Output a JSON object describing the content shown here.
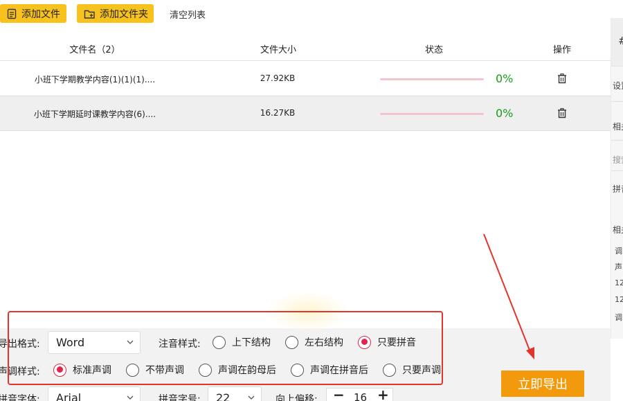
{
  "toolbar": {
    "add_file": "添加文件",
    "add_folder": "添加文件夹",
    "clear_list": "清空列表"
  },
  "table": {
    "headers": {
      "name": "文件名（2）",
      "size": "文件大小",
      "status": "状态",
      "action": "操作"
    },
    "rows": [
      {
        "name": "小班下学期教学内容(1)(1)(1)....",
        "size": "27.92KB",
        "progress_text": "0%",
        "progress": 0
      },
      {
        "name": "小班下学期延时课教学内容(6)....",
        "size": "16.27KB",
        "progress_text": "0%",
        "progress": 0
      }
    ]
  },
  "side_panel": {
    "items": [
      "#",
      "设置",
      "相关",
      "搜索",
      "拼音",
      "相关",
      "调",
      "声",
      "12",
      "12",
      "调"
    ]
  },
  "settings": {
    "export_format_label": "导出格式:",
    "export_format_value": "Word",
    "annotation_label": "注音样式:",
    "annotation_options": [
      {
        "label": "上下结构",
        "selected": false
      },
      {
        "label": "左右结构",
        "selected": false
      },
      {
        "label": "只要拼音",
        "selected": true
      }
    ],
    "tone_label": "声调样式:",
    "tone_options": [
      {
        "label": "标准声调",
        "selected": true
      },
      {
        "label": "不带声调",
        "selected": false
      },
      {
        "label": "声调在韵母后",
        "selected": false
      },
      {
        "label": "声调在拼音后",
        "selected": false
      },
      {
        "label": "只要声调",
        "selected": false
      }
    ],
    "pinyin_font_label": "拼音字体:",
    "pinyin_font_value": "Arial",
    "pinyin_size_label": "拼音字号:",
    "pinyin_size_value": "22",
    "offset_label": "向上偏移:",
    "offset_value": "16",
    "minus": "−",
    "plus": "+"
  },
  "export_button": "立即导出",
  "colors": {
    "toolbar_button": "#f7c21d",
    "export_button": "#f39a0c",
    "progress_track": "#f4c4ce",
    "percent_text": "#1a9a1a",
    "radio_selected": "#e0244d",
    "annotation_red": "#e2342c"
  },
  "icons": {
    "add_file": "file-add-icon",
    "add_folder": "folder-add-icon",
    "delete": "trash-icon",
    "dropdown": "chevron-down-icon"
  }
}
